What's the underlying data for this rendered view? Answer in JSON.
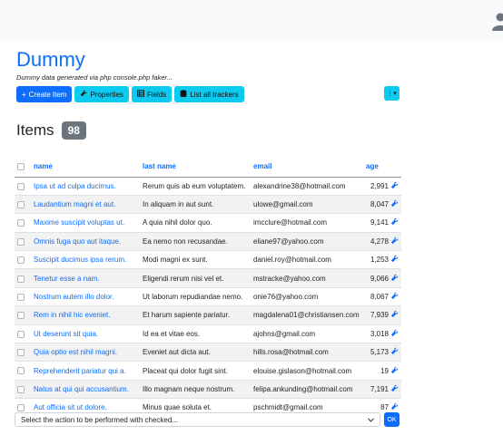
{
  "header": {
    "title": "Dummy",
    "subtitle": "Dummy data generated via php console.php faker..."
  },
  "toolbar": {
    "create_label": "Create Item",
    "properties_label": "Properties",
    "fields_label": "Fields",
    "trackers_label": "List all trackers",
    "menu_label": "⋮▾"
  },
  "items": {
    "title": "Items",
    "count": "98"
  },
  "table": {
    "columns": [
      "name",
      "last name",
      "email",
      "age"
    ],
    "rows": [
      {
        "name": "Ipsa ut ad culpa ducimus.",
        "last_name": "Rerum quis ab eum voluptatem.",
        "email": "alexandrine38@hotmail.com",
        "age": "2,991"
      },
      {
        "name": "Laudantium magni et aut.",
        "last_name": "In aliquam in aut sunt.",
        "email": "ulowe@gmail.com",
        "age": "8,047"
      },
      {
        "name": "Maxime suscipit voluptas ut.",
        "last_name": "A quia nihil dolor quo.",
        "email": "imcclure@hotmail.com",
        "age": "9,141"
      },
      {
        "name": "Omnis fuga quo aut itaque.",
        "last_name": "Ea nemo non recusandae.",
        "email": "eliane97@yahoo.com",
        "age": "4,278"
      },
      {
        "name": "Suscipit ducimus ipsa rerum.",
        "last_name": "Modi magni ex sunt.",
        "email": "daniel.roy@hotmail.com",
        "age": "1,253"
      },
      {
        "name": "Tenetur esse a nam.",
        "last_name": "Eligendi rerum nisi vel et.",
        "email": "mstracke@yahoo.com",
        "age": "9,066"
      },
      {
        "name": "Nostrum autem illo dolor.",
        "last_name": "Ut laborum repudiandae nemo.",
        "email": "onie76@yahoo.com",
        "age": "8,067"
      },
      {
        "name": "Rem in nihil hic eveniet.",
        "last_name": "Et harum sapiente pariatur.",
        "email": "magdalena01@christiansen.com",
        "age": "7,939"
      },
      {
        "name": "Ut deserunt sit quia.",
        "last_name": "Id ea et vitae eos.",
        "email": "ajohns@gmail.com",
        "age": "3,018"
      },
      {
        "name": "Quia optio est nihil magni.",
        "last_name": "Eveniet aut dicta aut.",
        "email": "hills.rosa@hotmail.com",
        "age": "5,173"
      },
      {
        "name": "Reprehenderit pariatur qui a.",
        "last_name": "Placeat qui dolor fugit sint.",
        "email": "elouise.gislason@hotmail.com",
        "age": "19"
      },
      {
        "name": "Natus at qui qui accusantium.",
        "last_name": "Illo magnam neque nostrum.",
        "email": "felipa.ankunding@hotmail.com",
        "age": "7,191"
      },
      {
        "name": "Aut officia sit ut dolore.",
        "last_name": "Minus quae soluta et.",
        "email": "pschmidt@gmail.com",
        "age": "87"
      }
    ]
  },
  "bulk": {
    "select_value": "Select the action to be performed with checked...",
    "ok_label": "OK"
  },
  "colors": {
    "primary": "#0d6efd",
    "info": "#0dcaf0",
    "badge": "#6c757d"
  }
}
